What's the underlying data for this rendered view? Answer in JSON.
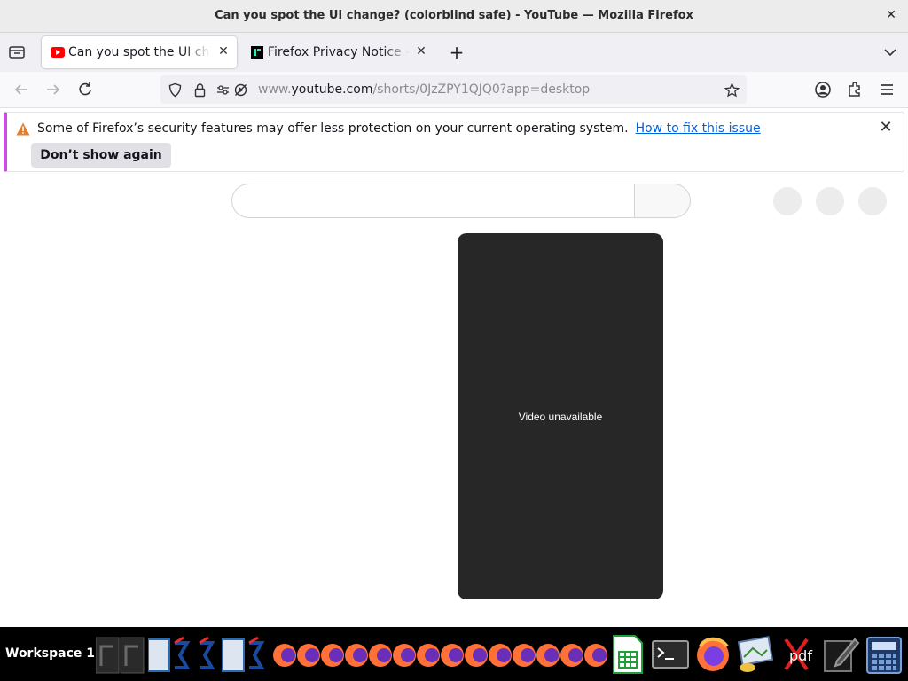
{
  "window": {
    "title": "Can you spot the UI change? (colorblind safe) - YouTube — Mozilla Firefox",
    "close_glyph": "✕"
  },
  "tabs": [
    {
      "label": "Can you spot the UI change? (colorblind safe) - YouTube",
      "icon": "youtube-icon",
      "active": true,
      "close_glyph": "✕"
    },
    {
      "label": "Firefox Privacy Notice — Mozilla",
      "icon": "mozilla-icon",
      "active": false,
      "close_glyph": "✕"
    }
  ],
  "newtab_glyph": "+",
  "url": {
    "prefix": "www.",
    "host": "youtube.com",
    "path": "/shorts/0JzZPY1QJQ0?app=desktop"
  },
  "notification": {
    "message": "Some of Firefox’s security features may offer less protection on your current operating system.",
    "link": "How to fix this issue",
    "button": "Don’t show again",
    "close_glyph": "✕"
  },
  "video": {
    "message": "Video unavailable"
  },
  "taskbar": {
    "workspace": "Workspace 1",
    "pdf_label": "pdf"
  },
  "colors": {
    "youtube_red": "#ff0000",
    "player_bg": "#272727",
    "link": "#0061e0",
    "notif_accent": "#c850e0"
  }
}
